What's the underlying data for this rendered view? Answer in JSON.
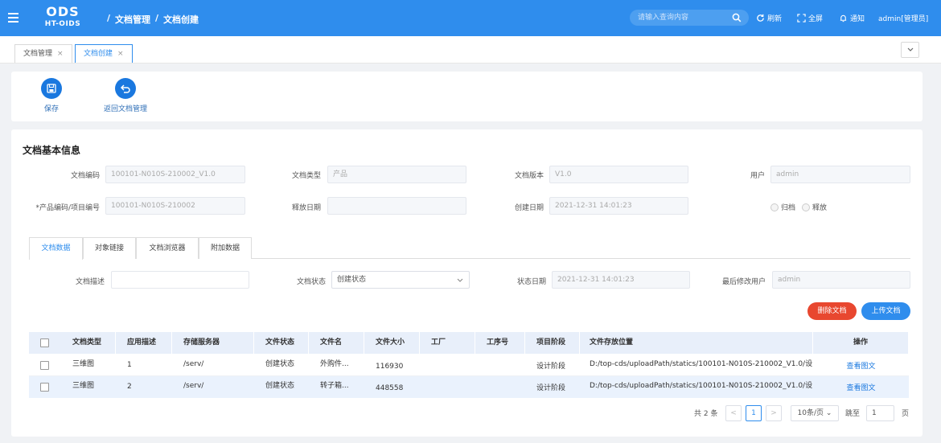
{
  "header": {
    "logo_top": "ODS",
    "logo_bottom": "HT-OIDS",
    "breadcrumb": [
      "/",
      "文档管理",
      "/",
      "文档创建"
    ],
    "search_placeholder": "请输入查询内容",
    "refresh": "刷新",
    "fullscreen": "全屏",
    "notify": "通知",
    "user": "admin[管理员]",
    "color": "#2f8ded"
  },
  "page_tabs": [
    {
      "label": "文档管理",
      "close": "×"
    },
    {
      "label": "文档创建",
      "close": "×"
    }
  ],
  "toolbar": {
    "save": "保存",
    "back": "返回文档管理"
  },
  "basic": {
    "title": "文档基本信息",
    "doc_code_label": "文档编码",
    "doc_code": "100101-N010S-210002_V1.0",
    "doc_type_label": "文档类型",
    "doc_type_placeholder": "产品",
    "doc_version_label": "文档版本",
    "doc_version": "V1.0",
    "user_label": "用户",
    "user": "admin",
    "product_code_label": "*产品编码/项目编号",
    "product_code": "100101-N010S-210002",
    "release_date_label": "释放日期",
    "release_date": "",
    "create_date_label": "创建日期",
    "create_date": "2021-12-31 14:01:23",
    "radio_archive": "归档",
    "radio_release": "释放"
  },
  "sub_tabs": [
    "文档数据",
    "对象链接",
    "文档浏览器",
    "附加数据"
  ],
  "doc_data": {
    "desc_label": "文档描述",
    "desc": "",
    "status_label": "文档状态",
    "status": "创建状态",
    "status_date_label": "状态日期",
    "status_date": "2021-12-31 14:01:23",
    "last_user_label": "最后修改用户",
    "last_user": "admin",
    "delete_btn": "删除文档",
    "upload_btn": "上传文档"
  },
  "table": {
    "columns": [
      "文档类型",
      "应用描述",
      "存储服务器",
      "文件状态",
      "文件名",
      "文件大小",
      "工厂",
      "工序号",
      "项目阶段",
      "文件存放位置",
      "操作"
    ],
    "rows": [
      {
        "type": "三维图",
        "desc": "1",
        "server": "/serv/",
        "status": "创建状态",
        "name": "外购件...",
        "size": "116930",
        "factory": "",
        "proc": "",
        "stage": "设计阶段",
        "path": "D:/top-cds/uploadPath/statics/100101-N010S-210002_V1.0/设...",
        "op": "查看图文"
      },
      {
        "type": "三维图",
        "desc": "2",
        "server": "/serv/",
        "status": "创建状态",
        "name": "转子箱...",
        "size": "448558",
        "factory": "",
        "proc": "",
        "stage": "设计阶段",
        "path": "D:/top-cds/uploadPath/statics/100101-N010S-210002_V1.0/设...",
        "op": "查看图文"
      }
    ]
  },
  "pager": {
    "total": "共 2 条",
    "prev": "<",
    "page": "1",
    "next": ">",
    "size": "10条/页",
    "goto": "跳至",
    "goto_value": "1",
    "page_unit": "页"
  }
}
